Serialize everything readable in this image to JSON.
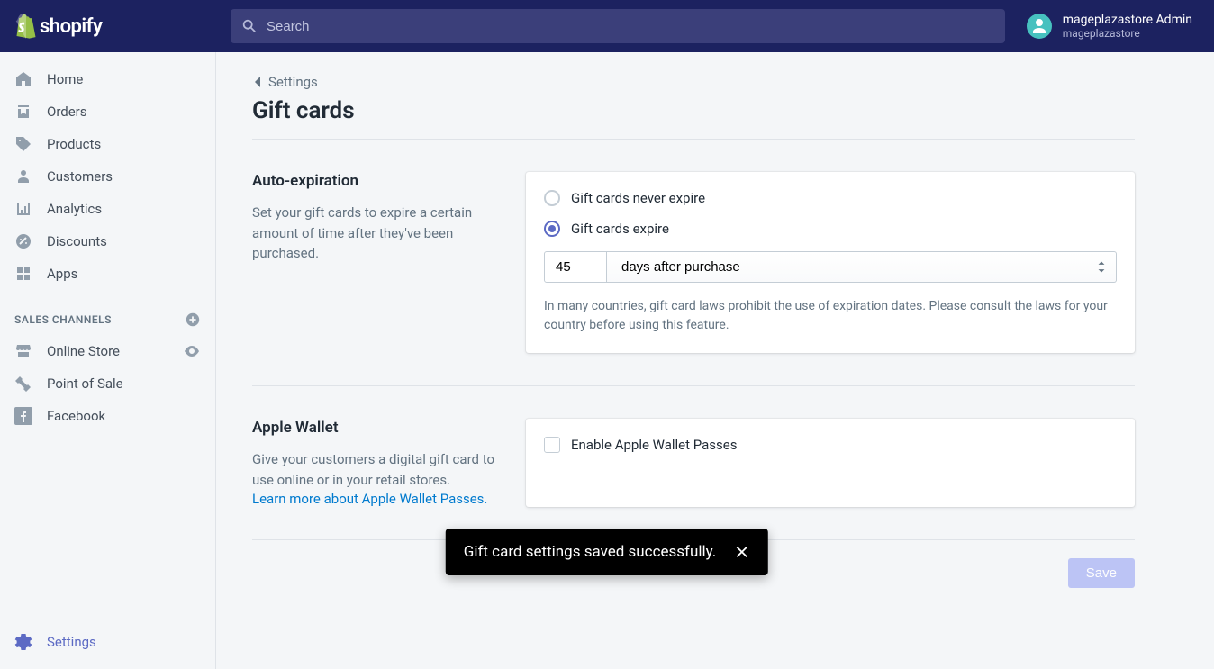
{
  "header": {
    "brand": "shopify",
    "search_placeholder": "Search",
    "user_name": "mageplazastore Admin",
    "store_name": "mageplazastore"
  },
  "sidebar": {
    "items": [
      {
        "label": "Home"
      },
      {
        "label": "Orders"
      },
      {
        "label": "Products"
      },
      {
        "label": "Customers"
      },
      {
        "label": "Analytics"
      },
      {
        "label": "Discounts"
      },
      {
        "label": "Apps"
      }
    ],
    "channels_heading": "SALES CHANNELS",
    "channels": [
      {
        "label": "Online Store"
      },
      {
        "label": "Point of Sale"
      },
      {
        "label": "Facebook"
      }
    ],
    "settings_label": "Settings"
  },
  "page": {
    "breadcrumb": "Settings",
    "title": "Gift cards"
  },
  "auto_expiration": {
    "heading": "Auto-expiration",
    "description": "Set your gift cards to expire a certain amount of time after they've been purchased.",
    "option_never": "Gift cards never expire",
    "option_expire": "Gift cards expire",
    "duration_value": "45",
    "duration_unit": "days after purchase",
    "help": "In many countries, gift card laws prohibit the use of expiration dates. Please consult the laws for your country before using this feature."
  },
  "apple_wallet": {
    "heading": "Apple Wallet",
    "description": "Give your customers a digital gift card to use online or in your retail stores.",
    "learn_more": "Learn more about Apple Wallet Passes.",
    "checkbox_label": "Enable Apple Wallet Passes"
  },
  "actions": {
    "save": "Save"
  },
  "toast": {
    "message": "Gift card settings saved successfully."
  }
}
